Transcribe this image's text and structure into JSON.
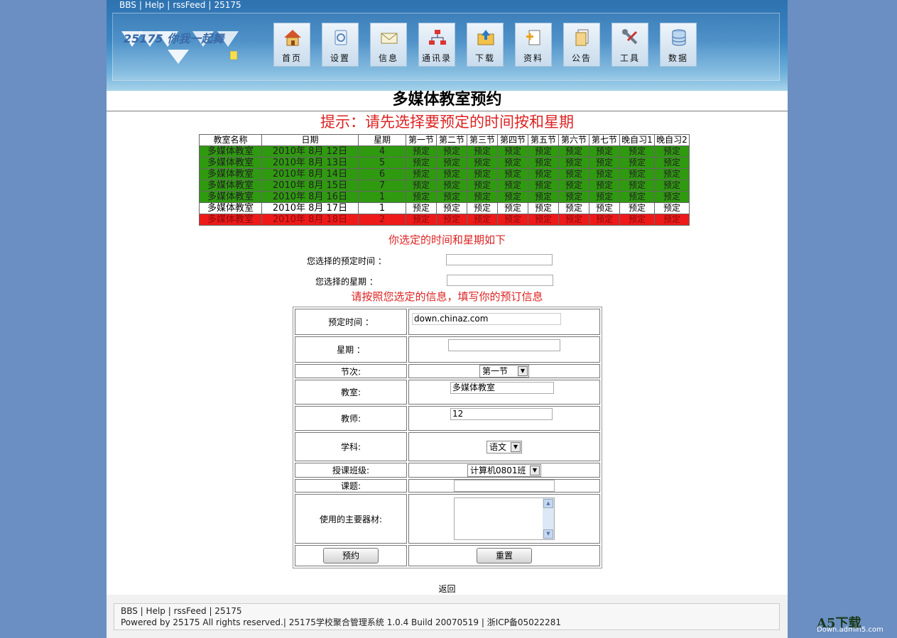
{
  "toplinks": [
    "BBS",
    "Help",
    "rssFeed",
    "25175"
  ],
  "logo": {
    "text": "25175 你我一起舞"
  },
  "nav": [
    {
      "label": "首页",
      "icon": "home-icon"
    },
    {
      "label": "设置",
      "icon": "settings-icon"
    },
    {
      "label": "信息",
      "icon": "mail-icon"
    },
    {
      "label": "通讯录",
      "icon": "network-icon"
    },
    {
      "label": "下载",
      "icon": "download-icon"
    },
    {
      "label": "资料",
      "icon": "document-add-icon"
    },
    {
      "label": "公告",
      "icon": "clipboard-icon"
    },
    {
      "label": "工具",
      "icon": "tools-icon"
    },
    {
      "label": "数据",
      "icon": "database-icon"
    }
  ],
  "page_title": "多媒体教室预约",
  "hint": "提示：请先选择要预定的时间按和星期",
  "schedule": {
    "headers": [
      "教室名称",
      "日期",
      "星期",
      "第一节",
      "第二节",
      "第三节",
      "第四节",
      "第五节",
      "第六节",
      "第七节",
      "晚自习1",
      "晚自习2"
    ],
    "rows": [
      {
        "status": "green",
        "room": "多媒体教室",
        "date": "2010年 8月 12日",
        "weekday": "4"
      },
      {
        "status": "green",
        "room": "多媒体教室",
        "date": "2010年 8月 13日",
        "weekday": "5"
      },
      {
        "status": "green",
        "room": "多媒体教室",
        "date": "2010年 8月 14日",
        "weekday": "6"
      },
      {
        "status": "green",
        "room": "多媒体教室",
        "date": "2010年 8月 15日",
        "weekday": "7"
      },
      {
        "status": "green",
        "room": "多媒体教室",
        "date": "2010年 8月 16日",
        "weekday": "1"
      },
      {
        "status": "white",
        "room": "多媒体教室",
        "date": "2010年 8月 17日",
        "weekday": "1"
      },
      {
        "status": "red",
        "room": "多媒体教室",
        "date": "2010年 8月 18日",
        "weekday": "2"
      }
    ],
    "cell_label": "预定"
  },
  "selected_label": "你选定的时间和星期如下",
  "selected": {
    "time_label": "您选择的预定时间 ：",
    "time_value": "",
    "weekday_label": "您选择的星期 ：",
    "weekday_value": ""
  },
  "fill_label": "请按照您选定的信息，填写你的预订信息",
  "form": {
    "time_label": "预定时间 ：",
    "time_value": "down.chinaz.com",
    "weekday_label": "星期 ：",
    "weekday_value": "",
    "period_label": "节次:",
    "period_value": "第一节",
    "room_label": "教室:",
    "room_value": "多媒体教室",
    "teacher_label": "教师:",
    "teacher_value": "12",
    "subject_label": "学科:",
    "subject_value": "语文",
    "class_label": "授课班级:",
    "class_value": "计算机0801班",
    "topic_label": "课题:",
    "topic_value": "",
    "equipment_label": "使用的主要器材:",
    "equipment_value": "",
    "submit_label": "预约",
    "reset_label": "重置"
  },
  "back_label": "返回",
  "footer": {
    "links": "BBS | Help | rssFeed | 25175",
    "copyright": "Powered by 25175 All rights reserved.| 25175学校聚合管理系统 1.0.4 Build 20070519 | 浙ICP备05022281"
  },
  "watermark": {
    "big": "A5下载",
    "small": "Down.admin5.com"
  },
  "colors": {
    "background": "#6b8fc2",
    "available": "#2f9a10",
    "booked": "#ee1a1a",
    "hint": "#dd2222"
  }
}
